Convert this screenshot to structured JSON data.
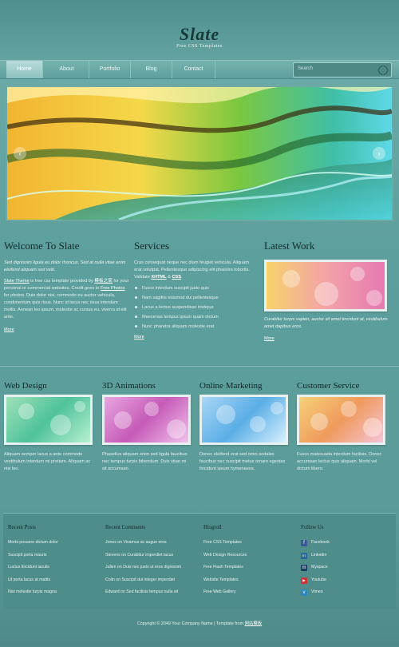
{
  "site": {
    "title": "Slate",
    "subtitle": "Free CSS Templates"
  },
  "nav": {
    "items": [
      "Home",
      "About",
      "Portfolio",
      "Blog",
      "Contact"
    ],
    "active_index": 0,
    "search_placeholder": "Search"
  },
  "welcome": {
    "heading": "Welcome To Slate",
    "lead": "Sed dignissim ligula eu dolor rhoncus. Sed at nulla vitae enim eleifend aliquam sed velit.",
    "body_link1": "Slate Theme",
    "body_part1": " is free css template provided by ",
    "body_link2": "模板之家",
    "body_part2": " for your personal or commercial websites. Credit goes to ",
    "body_link3": "Free Photos",
    "body_part3": " for photos. Duis dolor nisi, commodo eu auctor vehicula, condimentum quis risus. Nunc id lacus nec risus interdum mollis. Aenean leo ipsum, molestie ac cursus eu, viverra id elit ante.",
    "more": "More"
  },
  "services": {
    "heading": "Services",
    "text_part1": "Cras consequat neque nec diam feugiat vehicula. Aliquam erat volutpat. Pellentesque adipiscing elit pharetra lobortis. Validate ",
    "xhtml": "XHTML",
    "amp": " & ",
    "css": "CSS",
    "text_end": ".",
    "items": [
      "Fusce interdum suscipit justo quis",
      "Nam sagittis euismod dui pellentesque",
      "Lacus a lectus suspendisse tristique",
      "Maecenas tempus ipsum quam dictum",
      "Nunc pharetra aliquam molestie erat"
    ],
    "more": "More"
  },
  "latest": {
    "heading": "Latest Work",
    "caption": "Curabitur turpis sapien, auctor sit amet tincidunt at, vestibulum amet dapibus eros.",
    "more": "More"
  },
  "features": [
    {
      "title": "Web Design",
      "text": "Aliquam semper lacus a ante commodo vestibulum interdum mi pretium. Aliquam ac nisi leo."
    },
    {
      "title": "3D Animations",
      "text": "Phasellus aliquam enim sed ligula faucibus nec tempus turpis bibendum. Duis vitae mi sit accumsan."
    },
    {
      "title": "Online Marketing",
      "text": "Donec eleifend erat sed omni sodales faucibus nec suscipit metus ornare egestas tincidunt ipsum hymenaeos."
    },
    {
      "title": "Customer Service",
      "text": "Fusce malesuada interdum facilisis. Donec accumsan lectus quis aliquam. Morbi vel dictum libero."
    }
  ],
  "footer": {
    "recent_posts": {
      "title": "Recent Posts",
      "items": [
        "Morbi posuere dictum dolor",
        "Suscipit porta mauris",
        "Luctus tincidunt iaculis",
        "Ut porta lacus at mattis",
        "Nisi molestie turpis magna"
      ]
    },
    "recent_comments": {
      "title": "Recent Comments",
      "items": [
        "Jones on Vivamus ac augue eros",
        "Stevens on Curabitur imperdiet lacus",
        "Julien on Duis nec justo ut eros dignissim",
        "Colin on Suscipit dui integer imperdiet",
        "Edward on Sed facilisis tempus nulla sit"
      ]
    },
    "blogroll": {
      "title": "Blogroll",
      "items": [
        "Free CSS Templates",
        "Web Design Resources",
        "Free Flash Templates",
        "Website Templates",
        "Free Web Gallery"
      ]
    },
    "follow": {
      "title": "Follow Us",
      "items": [
        {
          "label": "Facebook",
          "icon": "facebook-icon",
          "color": "#3b5998",
          "glyph": "f"
        },
        {
          "label": "Linkedin",
          "icon": "linkedin-icon",
          "color": "#2a6a9a",
          "glyph": "in"
        },
        {
          "label": "Myspace",
          "icon": "myspace-icon",
          "color": "#1d3f66",
          "glyph": "m"
        },
        {
          "label": "Youtube",
          "icon": "youtube-icon",
          "color": "#c33",
          "glyph": "▶"
        },
        {
          "label": "Vimeo",
          "icon": "vimeo-icon",
          "color": "#2a8abf",
          "glyph": "v"
        }
      ]
    }
  },
  "copyright": {
    "text": "Copyright © 2049 Your Company Name | Template from ",
    "link": "网站模板"
  }
}
